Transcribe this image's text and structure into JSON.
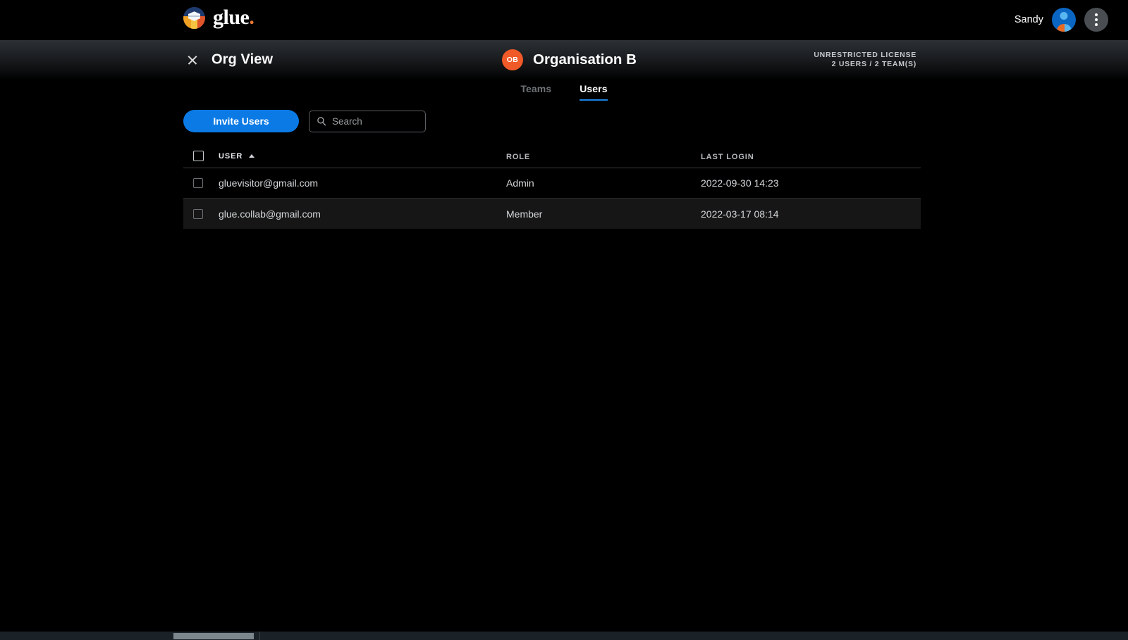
{
  "topbar": {
    "brand_name": "glue",
    "brand_dot": ".",
    "logo_icon": "glue-cube-logo-icon",
    "user_name": "Sandy",
    "avatar_icon": "user-avatar-icon",
    "menu_icon": "kebab-menu-icon"
  },
  "orgband": {
    "close_icon": "close-x-icon",
    "view_title": "Org View",
    "org_initials": "OB",
    "org_name": "Organisation B",
    "license_line1": "UNRESTRICTED LICENSE",
    "license_line2": "2 USERS / 2 TEAM(S)"
  },
  "tabs": [
    {
      "label": "Teams",
      "active": false
    },
    {
      "label": "Users",
      "active": true
    }
  ],
  "toolbar": {
    "invite_label": "Invite Users",
    "search_placeholder": "Search",
    "search_value": "",
    "search_icon": "search-icon"
  },
  "table": {
    "columns": [
      {
        "key": "user",
        "label": "USER",
        "sorted": "asc",
        "sort_icon": "caret-up-icon"
      },
      {
        "key": "role",
        "label": "ROLE",
        "sorted": "none"
      },
      {
        "key": "last_login",
        "label": "LAST LOGIN",
        "sorted": "none"
      }
    ],
    "select_all_checked": false,
    "rows": [
      {
        "checked": false,
        "user": "gluevisitor@gmail.com",
        "role": "Admin",
        "last_login": "2022-09-30 14:23"
      },
      {
        "checked": false,
        "user": "glue.collab@gmail.com",
        "role": "Member",
        "last_login": "2022-03-17 08:14"
      }
    ]
  },
  "colors": {
    "accent_blue": "#0b7ae5",
    "tab_underline": "#1a82e2",
    "org_badge_orange": "#f05a28",
    "brand_dot_orange": "#e8772e",
    "background": "#000000",
    "row_alt": "#161616"
  }
}
